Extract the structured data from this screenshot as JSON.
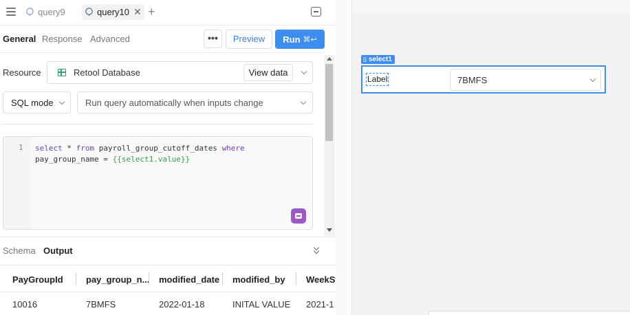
{
  "tabs": [
    {
      "label": "query9",
      "active": false
    },
    {
      "label": "query10",
      "active": true
    }
  ],
  "subtabs": [
    "General",
    "Response",
    "Advanced"
  ],
  "toolbar": {
    "more_label": "•••",
    "preview_label": "Preview",
    "run_label": "Run",
    "run_shortcut": "⌘↩"
  },
  "resource": {
    "label": "Resource",
    "name": "Retool Database",
    "view_data_label": "View data"
  },
  "mode": {
    "sql_mode": "SQL mode",
    "trigger": "Run query automatically when inputs change"
  },
  "editor": {
    "line_number": "1",
    "line1_kw1": "select",
    "line1_mid": " * ",
    "line1_kw2": "from",
    "line1_table": " payroll_group_cutoff_dates ",
    "line1_kw3": "where",
    "line2_prefix": "pay_group_name = ",
    "line2_template": "{{select1.value}}"
  },
  "output": {
    "tabs": [
      "Schema",
      "Output"
    ],
    "columns": [
      "PayGroupId",
      "pay_group_n...",
      "modified_date",
      "modified_by",
      "WeekSt"
    ],
    "rows": [
      [
        "10016",
        "7BMFS",
        "2022-01-18",
        "INITAL VALUE",
        "2021-1"
      ]
    ]
  },
  "canvas": {
    "component_tag": "select1",
    "component_label": "Label",
    "component_value": "7BMFS"
  },
  "colors": {
    "accent": "#3d8ef0",
    "db_icon": "#2ea36b",
    "ai_button": "#9b59c8"
  }
}
